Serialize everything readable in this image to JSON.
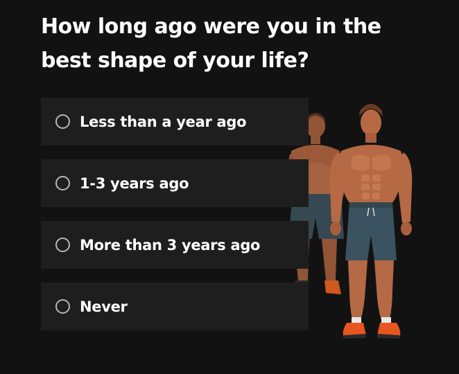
{
  "question": {
    "title": "How long ago were you in the best shape of your life?"
  },
  "options": [
    {
      "label": "Less than a year ago"
    },
    {
      "label": "1-3 years ago"
    },
    {
      "label": "More than 3 years ago"
    },
    {
      "label": "Never"
    }
  ],
  "illustration": {
    "description": "before-after-men-illustration",
    "colors": {
      "skin": "#b56a45",
      "shorts": "#3b5260",
      "shoes": "#e8551e",
      "hair": "#6b3a22"
    }
  }
}
